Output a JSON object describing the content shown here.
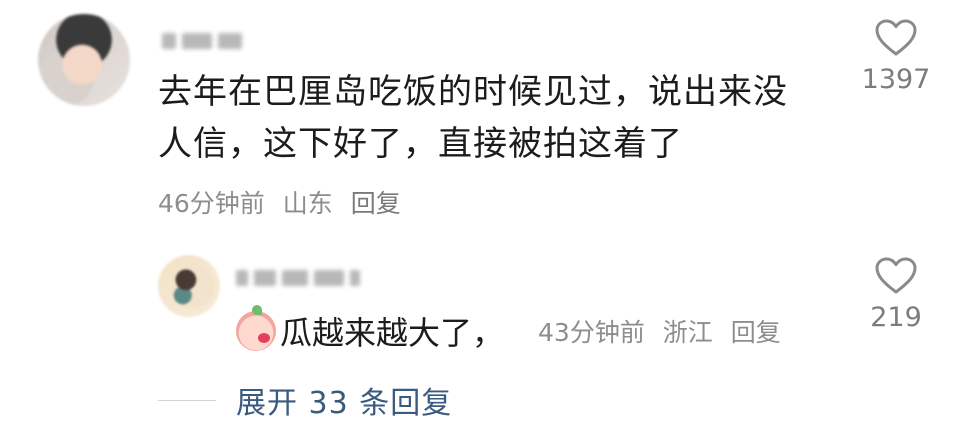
{
  "comment": {
    "text": "去年在巴厘岛吃饭的时候见过，说出来没人信，这下好了，直接被拍这着了",
    "time": "46分钟前",
    "location": "山东",
    "reply_label": "回复",
    "likes": "1397",
    "like_icon": "heart-outline-icon"
  },
  "reply": {
    "emoji_icon": "peach-kiss-emoji",
    "text": "瓜越来越大了，",
    "time": "43分钟前",
    "location": "浙江",
    "reply_label": "回复",
    "likes": "219",
    "like_icon": "heart-outline-icon"
  },
  "expand_replies": {
    "label": "展开 33 条回复"
  },
  "colors": {
    "meta_gray": "#8d8d8d",
    "link_blue": "#3a5a80",
    "text": "#1c1c1c"
  }
}
